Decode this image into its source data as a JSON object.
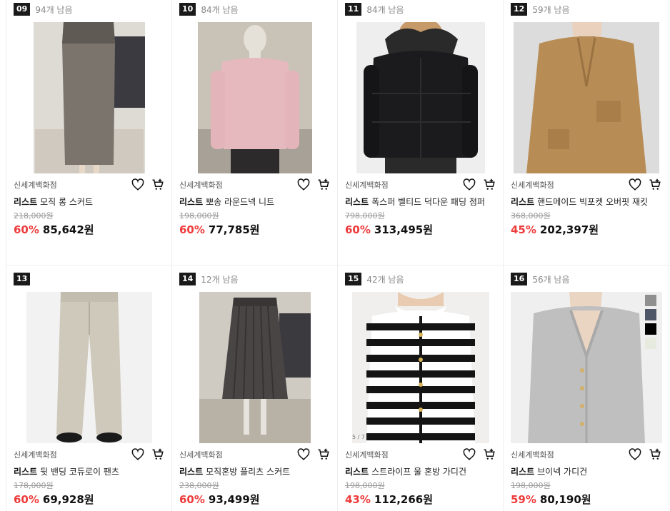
{
  "products": [
    {
      "rank": "09",
      "left": "94개 남음",
      "store": "신세계백화점",
      "brand": "리스트",
      "name": "모직 롱 스커트",
      "original": "218,000원",
      "discount": "60%",
      "price": "85,642원",
      "image": "wool-long-skirt"
    },
    {
      "rank": "10",
      "left": "84개 남음",
      "store": "신세계백화점",
      "brand": "리스트",
      "name": "뽀송 라운드넥 니트",
      "original": "198,000원",
      "discount": "60%",
      "price": "77,785원",
      "image": "pink-round-neck-knit"
    },
    {
      "rank": "11",
      "left": "84개 남음",
      "store": "신세계백화점",
      "brand": "리스트",
      "name": "폭스퍼 벨티드 덕다운 패딩 점퍼",
      "original": "798,000원",
      "discount": "60%",
      "price": "313,495원",
      "image": "black-down-padding"
    },
    {
      "rank": "12",
      "left": "59개 남음",
      "store": "신세계백화점",
      "brand": "리스트",
      "name": "핸드메이드 빅포켓 오버핏 재킷",
      "original": "368,000원",
      "discount": "45%",
      "price": "202,397원",
      "image": "camel-handmade-jacket"
    },
    {
      "rank": "13",
      "left": "",
      "store": "신세계백화점",
      "brand": "리스트",
      "name": "뒷 밴딩 코듀로이 팬츠",
      "original": "178,000원",
      "discount": "60%",
      "price": "69,928원",
      "image": "corduroy-pants"
    },
    {
      "rank": "14",
      "left": "12개 남음",
      "store": "신세계백화점",
      "brand": "리스트",
      "name": "모직혼방 플리츠 스커트",
      "original": "238,000원",
      "discount": "60%",
      "price": "93,499원",
      "image": "pleated-skirt"
    },
    {
      "rank": "15",
      "left": "42개 남음",
      "store": "신세계백화점",
      "brand": "리스트",
      "name": "스트라이프 울 혼방 가디건",
      "original": "198,000원",
      "discount": "43%",
      "price": "112,266원",
      "image": "striped-cardigan",
      "image_tag": "5 / 7"
    },
    {
      "rank": "16",
      "left": "56개 남음",
      "store": "신세계백화점",
      "brand": "리스트",
      "name": "브이넥 가디건",
      "original": "198,000원",
      "discount": "59%",
      "price": "80,190원",
      "image": "vneck-grey-cardigan"
    }
  ],
  "colors": {
    "discount": "#ee3b3b",
    "rank_bg": "#1a1a1a"
  },
  "icons": {
    "wishlist": "heart-icon",
    "cart": "cart-icon"
  }
}
